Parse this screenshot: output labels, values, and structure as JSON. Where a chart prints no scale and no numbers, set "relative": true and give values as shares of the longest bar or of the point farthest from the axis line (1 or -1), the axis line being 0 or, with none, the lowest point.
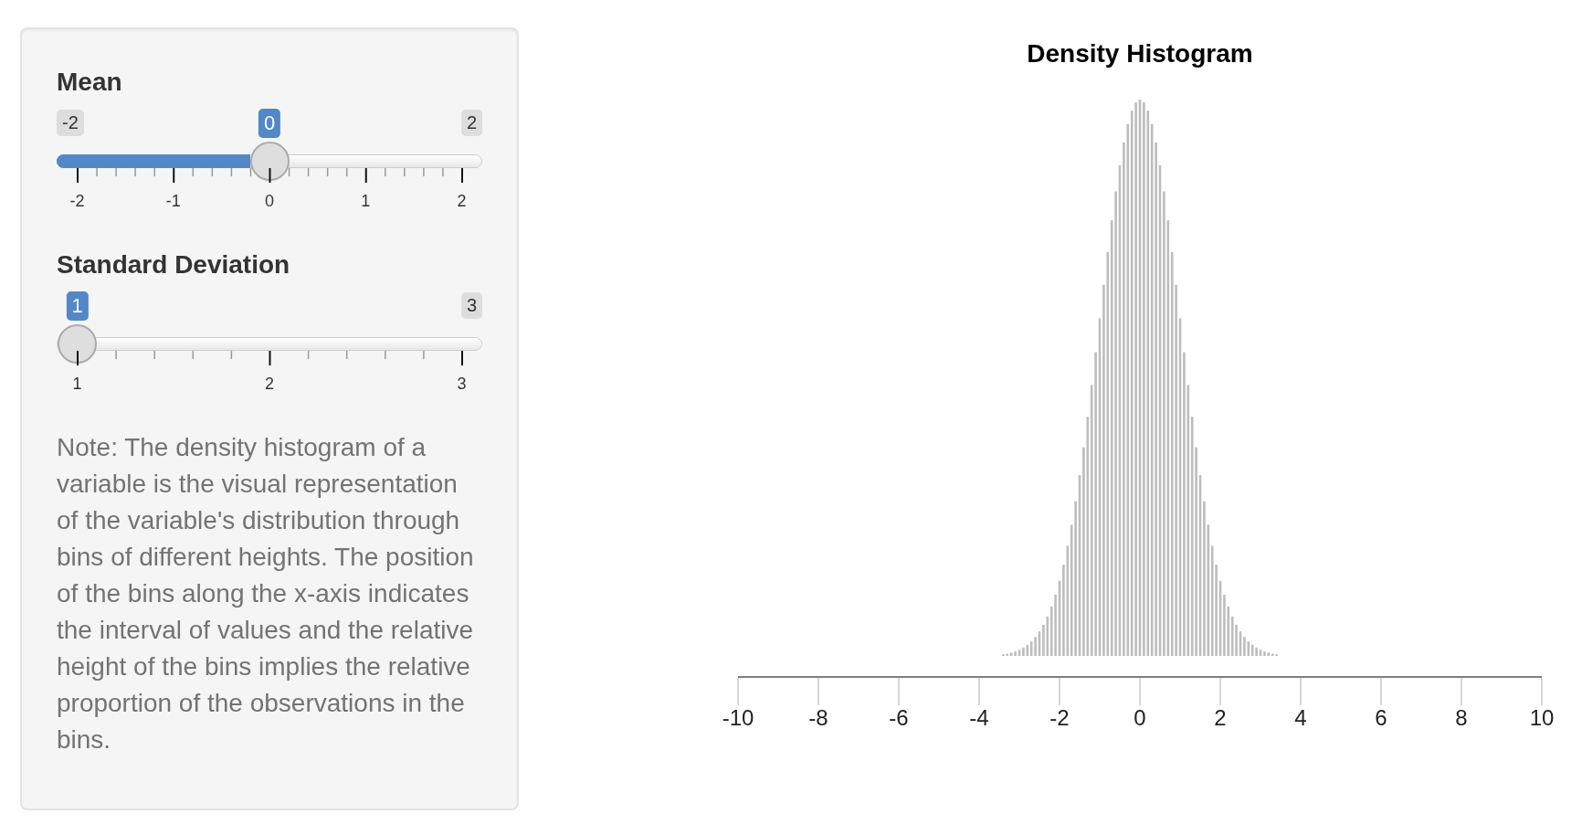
{
  "sidebar": {
    "sliders": [
      {
        "label": "Mean",
        "min": "-2",
        "max": "2",
        "value": "0",
        "level": 0.5,
        "ticks": [
          "-2",
          "-1",
          "0",
          "1",
          "2"
        ]
      },
      {
        "label": "Standard Deviation",
        "max": "3",
        "value": "1",
        "level": 0,
        "ticks": [
          "1",
          "2",
          "3"
        ]
      }
    ],
    "note": "Note: The density histogram of a variable is the visual representation of the variable's distribution through bins of different heights. The position of the bins along the x-axis indicates the interval of values and the relative height of the bins implies the relative proportion of the observations in the bins."
  },
  "main": {
    "chart_data": {
      "type": "bar",
      "title": "Density Histogram",
      "relative": true,
      "xlim": [
        -10,
        10
      ],
      "xticks": [
        -10,
        -8,
        -6,
        -4,
        -2,
        0,
        2,
        4,
        6,
        8,
        10
      ],
      "x": [
        -3.4,
        -3.3,
        -3.2,
        -3.1,
        -3.0,
        -2.9,
        -2.8,
        -2.7,
        -2.6,
        -2.5,
        -2.4,
        -2.3,
        -2.2,
        -2.1,
        -2.0,
        -1.9,
        -1.8,
        -1.7,
        -1.6,
        -1.5,
        -1.4,
        -1.3,
        -1.2,
        -1.1,
        -1.0,
        -0.9,
        -0.8,
        -0.7,
        -0.6,
        -0.5,
        -0.4,
        -0.3,
        -0.2,
        -0.1,
        0.0,
        0.1,
        0.2,
        0.3,
        0.4,
        0.5,
        0.6,
        0.7,
        0.8,
        0.9,
        1.0,
        1.1,
        1.2,
        1.3,
        1.4,
        1.5,
        1.6,
        1.7,
        1.8,
        1.9,
        2.0,
        2.1,
        2.2,
        2.3,
        2.4,
        2.5,
        2.6,
        2.7,
        2.8,
        2.9,
        3.0,
        3.1,
        3.2,
        3.3,
        3.4
      ],
      "values": [
        0.003,
        0.004,
        0.006,
        0.008,
        0.011,
        0.015,
        0.02,
        0.026,
        0.034,
        0.044,
        0.056,
        0.071,
        0.089,
        0.11,
        0.135,
        0.164,
        0.198,
        0.236,
        0.278,
        0.325,
        0.375,
        0.43,
        0.487,
        0.546,
        0.607,
        0.667,
        0.726,
        0.783,
        0.835,
        0.882,
        0.923,
        0.956,
        0.98,
        0.995,
        1.0,
        0.995,
        0.98,
        0.956,
        0.923,
        0.882,
        0.835,
        0.783,
        0.726,
        0.667,
        0.607,
        0.546,
        0.487,
        0.43,
        0.375,
        0.325,
        0.278,
        0.236,
        0.198,
        0.164,
        0.135,
        0.11,
        0.089,
        0.071,
        0.056,
        0.044,
        0.034,
        0.026,
        0.02,
        0.015,
        0.011,
        0.008,
        0.006,
        0.004,
        0.003
      ]
    }
  }
}
